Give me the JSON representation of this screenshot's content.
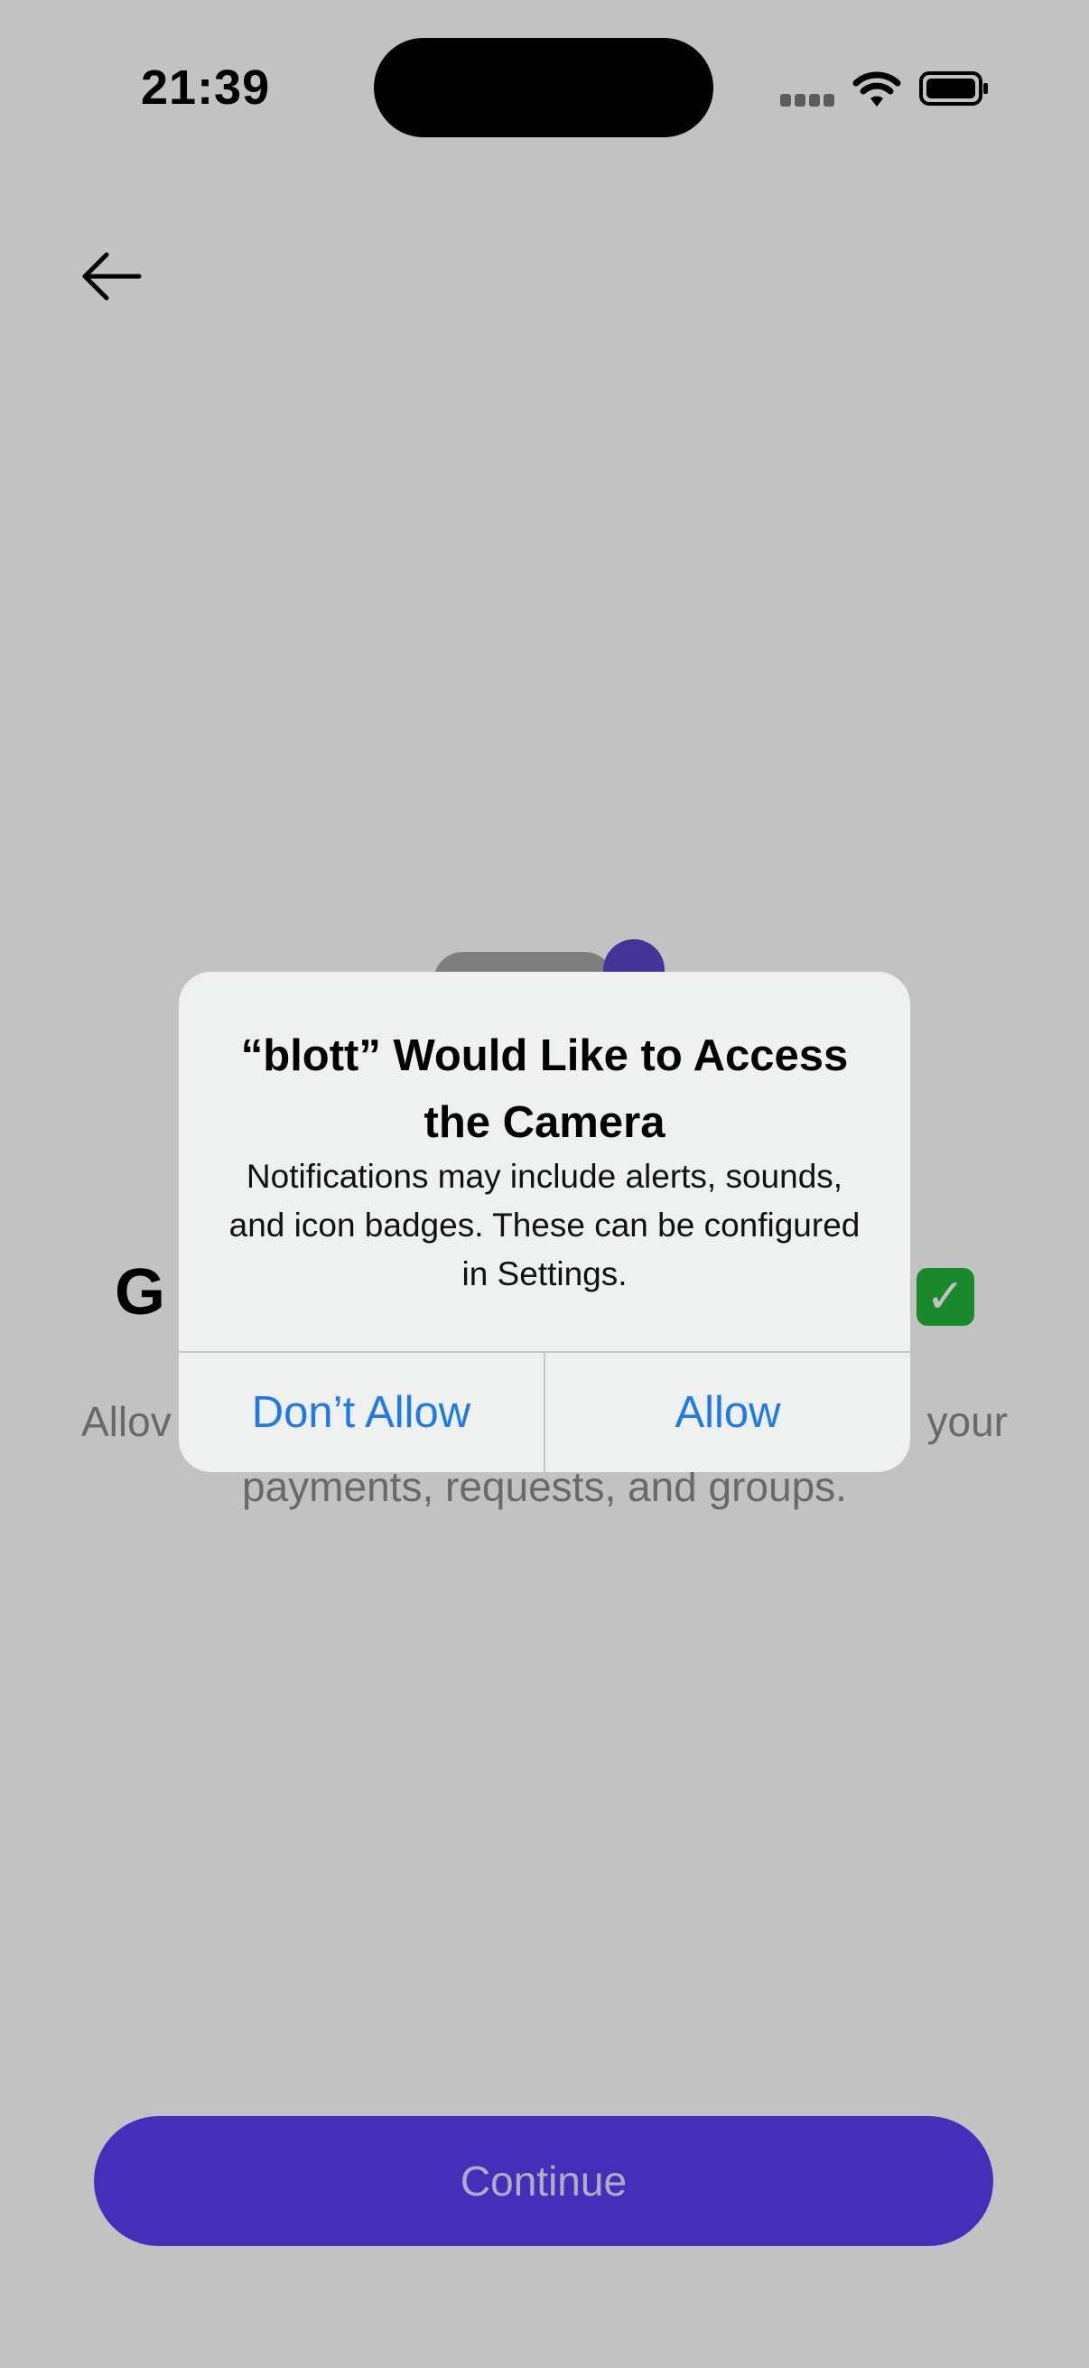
{
  "status_bar": {
    "time": "21:39",
    "signal_icon": "cellular-signal-icon",
    "wifi_icon": "wifi-icon",
    "battery_icon": "battery-icon"
  },
  "nav": {
    "back_icon": "arrow-left-icon"
  },
  "content": {
    "illustration_icon": "toggle-switch-icon",
    "heading_visible": "G",
    "heading_emoji_icon": "check-mark-button-icon",
    "subtitle_visible_left": "Allov",
    "subtitle_visible_right": "your",
    "subtitle_line2": "payments, requests, and groups."
  },
  "continue_button": {
    "label": "Continue"
  },
  "alert": {
    "title": "“blott” Would Like to Access the Camera",
    "message": "Notifications may include alerts, sounds, and icon badges. These can be configured in Settings.",
    "deny_label": "Don’t Allow",
    "allow_label": "Allow"
  },
  "colors": {
    "accent": "#5B3EF5",
    "alert_button_text": "#1F7AE8",
    "toggle_knob": "#5B45C8"
  }
}
